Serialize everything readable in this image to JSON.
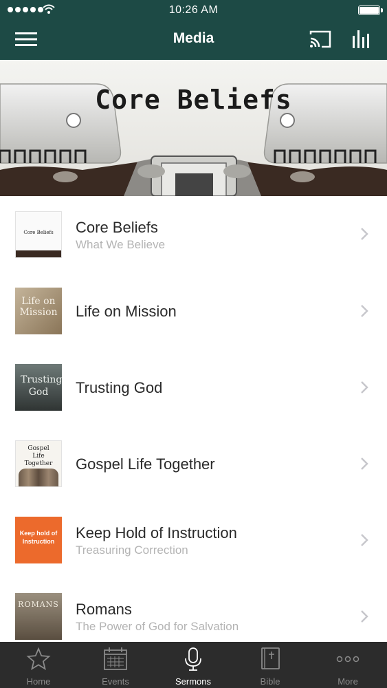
{
  "status_bar": {
    "time": "10:26 AM"
  },
  "header": {
    "title": "Media"
  },
  "banner": {
    "title": "Core Beliefs"
  },
  "series": [
    {
      "title": "Core Beliefs",
      "subtitle": "What We Believe",
      "thumb_text": "Core Beliefs"
    },
    {
      "title": "Life on Mission",
      "subtitle": "",
      "thumb_text": "Life on Mission"
    },
    {
      "title": "Trusting God",
      "subtitle": "",
      "thumb_text": "Trusting God"
    },
    {
      "title": "Gospel Life Together",
      "subtitle": "",
      "thumb_text": "Gospel Life Together"
    },
    {
      "title": "Keep Hold of Instruction",
      "subtitle": "Treasuring Correction",
      "thumb_text": "Keep hold of Instruction"
    },
    {
      "title": "Romans",
      "subtitle": "The Power of God for Salvation",
      "thumb_text": "ROMANS"
    }
  ],
  "tabs": [
    {
      "label": "Home",
      "icon": "star-icon",
      "active": false
    },
    {
      "label": "Events",
      "icon": "calendar-icon",
      "active": false
    },
    {
      "label": "Sermons",
      "icon": "microphone-icon",
      "active": true
    },
    {
      "label": "Bible",
      "icon": "book-icon",
      "active": false
    },
    {
      "label": "More",
      "icon": "more-dots-icon",
      "active": false
    }
  ],
  "colors": {
    "header_bg": "#1d4a45",
    "tabbar_bg": "#2c2c2c",
    "subtitle": "#b4b4b4",
    "tab_inactive": "#8a8a8a"
  }
}
